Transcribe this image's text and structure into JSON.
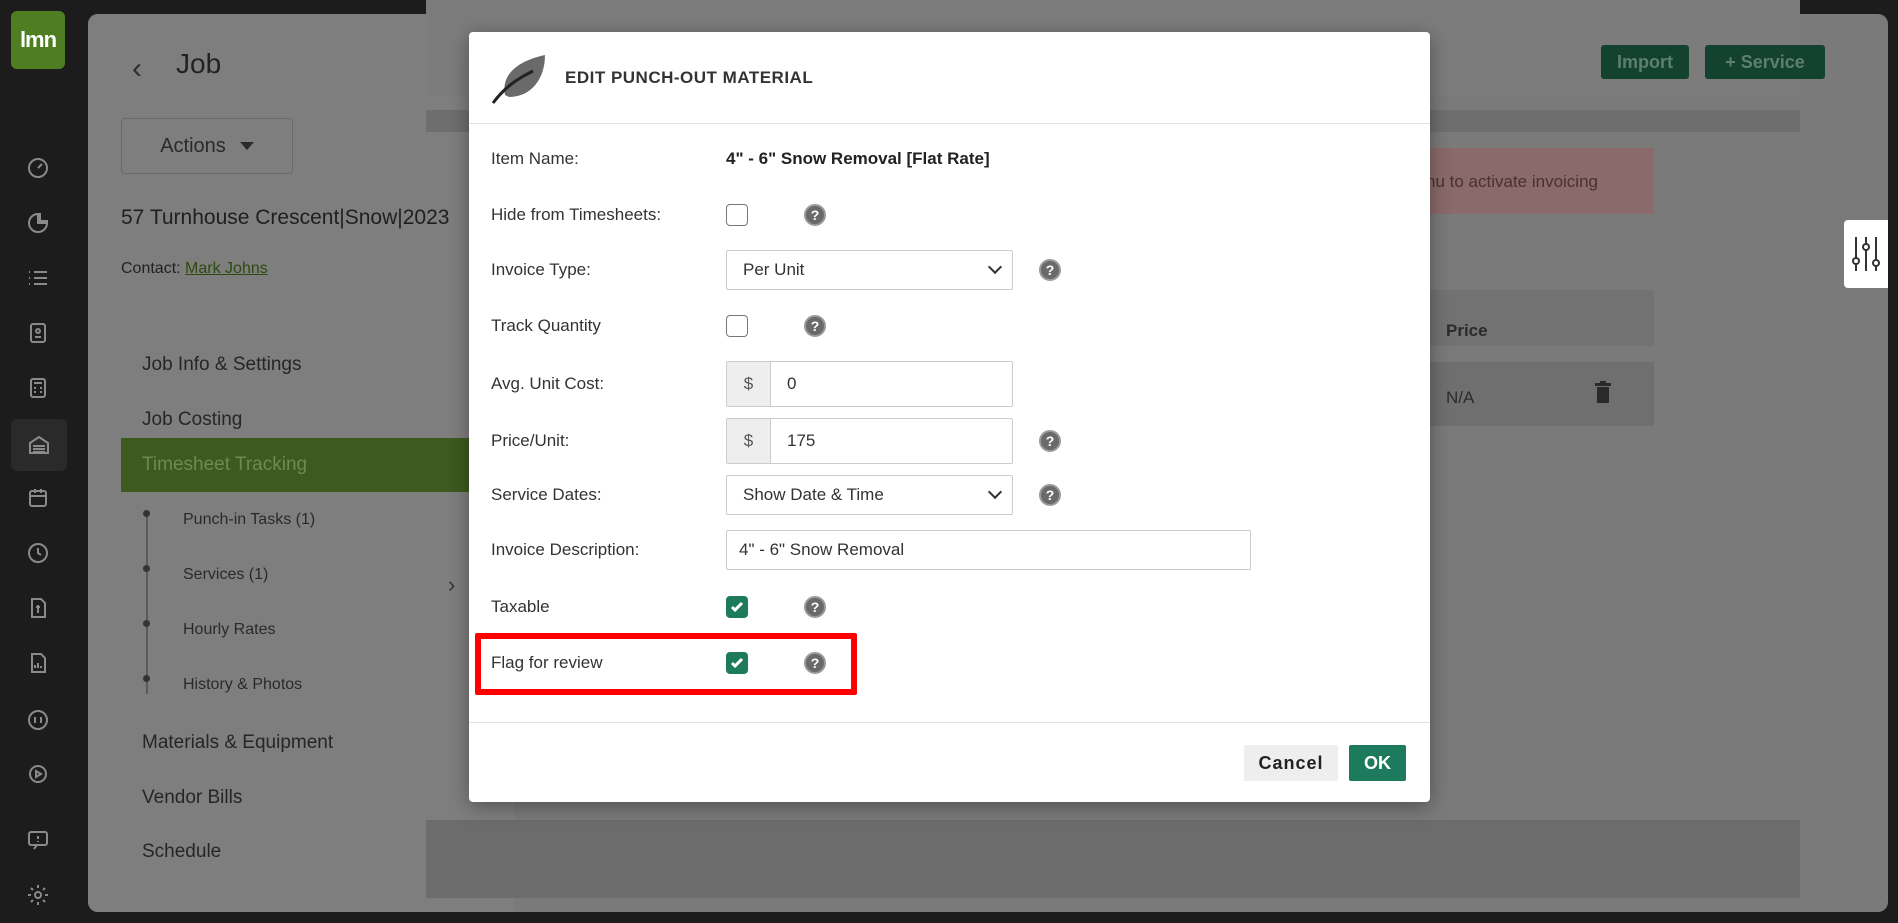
{
  "rail": {
    "logo": "lmn",
    "icons": [
      "dashboard-icon",
      "pie-chart-icon",
      "list-icon",
      "contact-card-icon",
      "calculator-icon",
      "jobs-icon",
      "calendar-icon",
      "clock-icon",
      "invoice-icon",
      "report-icon",
      "quickbooks-icon",
      "play-icon",
      "help-chat-icon",
      "settings-icon"
    ]
  },
  "background": {
    "job_title": "Job",
    "actions_label": "Actions",
    "job_name": "57 Turnhouse Crescent|Snow|2023",
    "contact_label": "Contact:",
    "contact_name": "Mark Johns",
    "nav": {
      "job_info": "Job Info & Settings",
      "job_costing": "Job Costing",
      "timesheet_tracking": "Timesheet Tracking",
      "punch_in_tasks": "Punch-in Tasks (1)",
      "services": "Services (1)",
      "hourly_rates": "Hourly Rates",
      "history_photos": "History & Photos",
      "materials_equipment": "Materials & Equipment",
      "vendor_bills": "Vendor Bills",
      "schedule": "Schedule"
    },
    "import_label": "Import",
    "service_label": "+ Service",
    "alert_text": "nu to activate invoicing",
    "price_header": "Price",
    "price_value": "N/A"
  },
  "modal": {
    "title": "EDIT PUNCH-OUT MATERIAL",
    "item_name_label": "Item Name:",
    "item_name_value": "4\" - 6\" Snow Removal [Flat Rate]",
    "hide_timesheets_label": "Hide from Timesheets:",
    "hide_timesheets_checked": false,
    "invoice_type_label": "Invoice Type:",
    "invoice_type_value": "Per Unit",
    "track_quantity_label": "Track Quantity",
    "track_quantity_checked": false,
    "avg_unit_cost_label": "Avg. Unit Cost:",
    "currency_symbol": "$",
    "avg_unit_cost_value": "0",
    "price_unit_label": "Price/Unit:",
    "price_unit_value": "175",
    "service_dates_label": "Service Dates:",
    "service_dates_value": "Show Date & Time",
    "invoice_description_label": "Invoice Description:",
    "invoice_description_value": "4\" - 6\" Snow Removal",
    "taxable_label": "Taxable",
    "taxable_checked": true,
    "flag_review_label": "Flag for review",
    "flag_review_checked": true,
    "help_glyph": "?",
    "cancel_label": "Cancel",
    "ok_label": "OK"
  },
  "colors": {
    "brand_green": "#1e7a5c",
    "highlight": "#ff0000"
  }
}
